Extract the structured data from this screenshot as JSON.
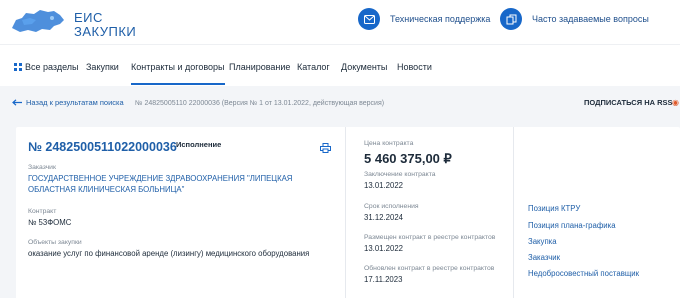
{
  "header": {
    "logo_line1": "ЕИС",
    "logo_line2": "ЗАКУПКИ",
    "support_label": "Техническая поддержка",
    "faq_label": "Часто задаваемые вопросы"
  },
  "nav": {
    "items": [
      {
        "label": "Все разделы"
      },
      {
        "label": "Закупки"
      },
      {
        "label": "Контракты и договоры"
      },
      {
        "label": "Планирование"
      },
      {
        "label": "Каталог"
      },
      {
        "label": "Документы"
      },
      {
        "label": "Новости"
      }
    ]
  },
  "breadcrumb": {
    "back_label": "Назад к результатам поиска",
    "path": "№ 24825005110 22000036 (Версия № 1 от 13.01.2022, действующая версия)",
    "rss_label": "ПОДПИСАТЬСЯ НА RSS"
  },
  "card": {
    "contract_number": "№ 2482500511022000036",
    "status": "Исполнение",
    "customer_label": "Заказчик",
    "customer_name": "ГОСУДАРСТВЕННОЕ УЧРЕЖДЕНИЕ ЗДРАВООХРАНЕНИЯ \"ЛИПЕЦКАЯ ОБЛАСТНАЯ КЛИНИЧЕСКАЯ БОЛЬНИЦА\"",
    "contract_label": "Контракт",
    "contract_value": "№ 53ФОМС",
    "objects_label": "Объекты закупки",
    "objects_value": "оказание услуг по финансовой аренде (лизингу) медицинского оборудования",
    "price_label": "Цена контракта",
    "price_value": "5 460 375,00 ₽",
    "date_label": "Заключение контракта",
    "date_value": "13.01.2022",
    "term_label": "Срок исполнения",
    "term_value": "31.12.2024",
    "posted_label": "Размещен контракт в реестре контрактов",
    "posted_value": "13.01.2022",
    "updated_label": "Обновлен контракт в реестре контрактов",
    "updated_value": "17.11.2023",
    "right_links": [
      {
        "label": "Позиция КТРУ"
      },
      {
        "label": "Позиция плана-графика"
      },
      {
        "label": "Закупка"
      },
      {
        "label": "Заказчик"
      },
      {
        "label": "Недобросовестный поставщик"
      }
    ]
  }
}
